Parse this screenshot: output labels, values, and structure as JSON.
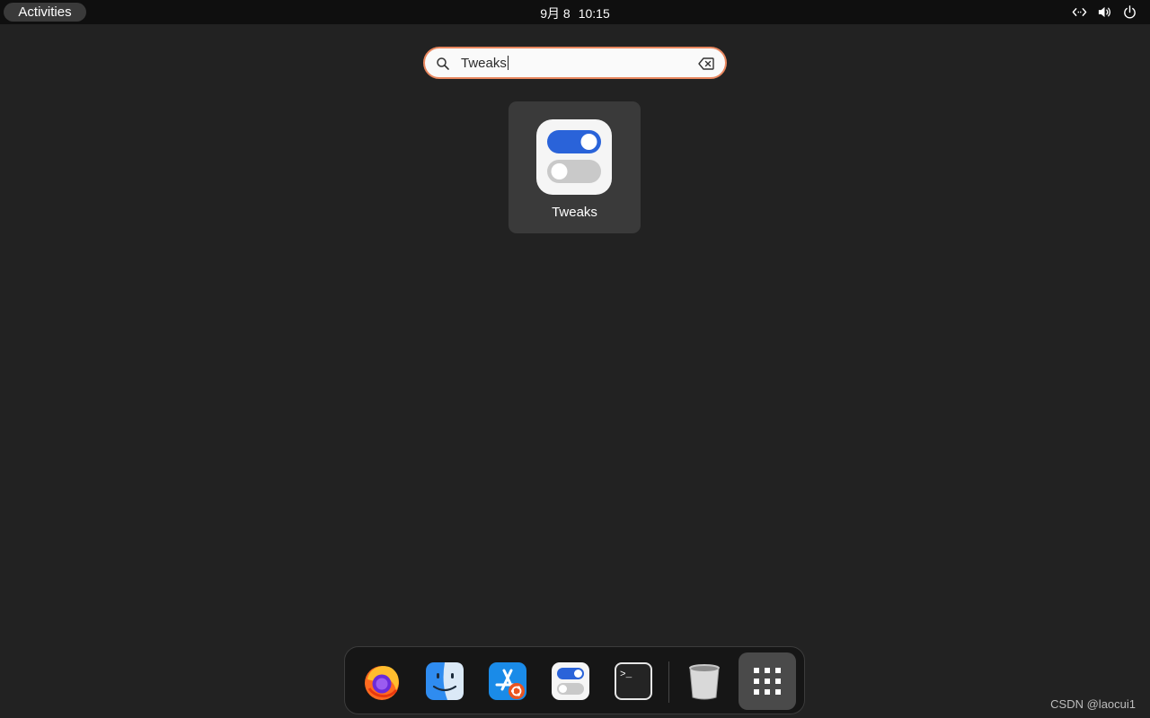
{
  "topbar": {
    "activities_label": "Activities",
    "date": "9月 8",
    "time": "10:15",
    "tray_icons": [
      "network-wired-icon",
      "volume-icon",
      "power-icon"
    ]
  },
  "search": {
    "value": "Tweaks",
    "icons": [
      "search-icon",
      "clear-text-icon"
    ],
    "focus_color": "#e9875f"
  },
  "results": [
    {
      "label": "Tweaks",
      "icon": "tweaks-icon"
    }
  ],
  "dock": {
    "items": [
      {
        "name": "firefox",
        "icon": "firefox-icon"
      },
      {
        "name": "files",
        "icon": "finder-icon"
      },
      {
        "name": "app-store",
        "icon": "app-store-icon"
      },
      {
        "name": "tweaks",
        "icon": "tweaks-icon"
      },
      {
        "name": "terminal",
        "icon": "terminal-icon"
      },
      {
        "name": "trash",
        "icon": "trash-icon"
      },
      {
        "name": "show-applications",
        "icon": "app-grid-icon"
      }
    ],
    "terminal_prompt": ">_"
  },
  "watermark": "CSDN @laocui1",
  "colors": {
    "background": "#222222",
    "topbar": "#0f0f0f",
    "accent_orange": "#e9875f",
    "toggle_blue": "#2a63d9"
  }
}
